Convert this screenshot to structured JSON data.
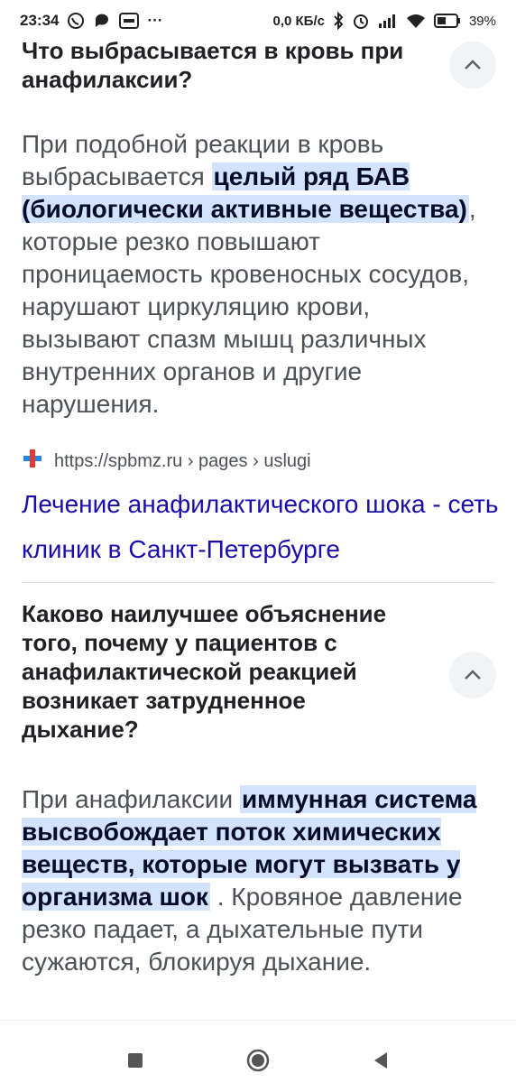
{
  "status_bar": {
    "time": "23:34",
    "dots": "···",
    "net_speed": "0,0 КБ/с",
    "battery": "39%"
  },
  "items": [
    {
      "question": "Что выбрасывается в кровь при анафилаксии?",
      "answer_pre": "При подобной реакции в кровь выбрасывается ",
      "answer_highlight": "целый ряд БАВ (биологически активные вещества)",
      "answer_post": ", которые резко повышают проницаемость кровеносных сосудов, нарушают циркуляцию крови, вызывают спазм мышц различных внутренних органов и другие нарушения.",
      "source_url": "https://spbmz.ru › pages › uslugi",
      "source_title": "Лечение анафилактического шока - сеть клиник в Санкт-Петербурге"
    },
    {
      "question": "Каково наилучшее объяснение того, почему у пациентов с анафилактической реакцией возникает затрудненное дыхание?",
      "answer_pre": "При анафилаксии ",
      "answer_highlight": "иммунная система высвобождает поток химических веществ, которые могут вызвать у организма шок",
      "answer_post": " . Кровяное давление резко падает, а дыхательные пути сужаются, блокируя дыхание."
    }
  ],
  "icons": {
    "collapse": "chevron-up-icon",
    "nav": [
      "recent-apps-icon",
      "home-icon",
      "back-icon"
    ]
  },
  "colors": {
    "highlight": "#d3e3fd",
    "link": "#1a0dab"
  }
}
